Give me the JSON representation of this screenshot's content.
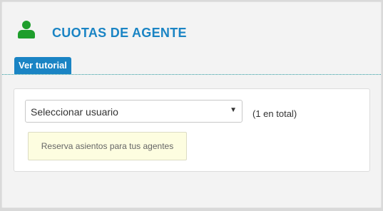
{
  "header": {
    "title": "CUOTAS DE AGENTE",
    "icon": "user-icon",
    "icon_color": "#1f9e2c",
    "title_color": "#1a84c4"
  },
  "tutorial": {
    "label": "Ver tutorial"
  },
  "form": {
    "user_select": {
      "selected": "Seleccionar usuario"
    },
    "total_text": "(1 en total)",
    "notice": "Reserva asientos para tus agentes"
  }
}
